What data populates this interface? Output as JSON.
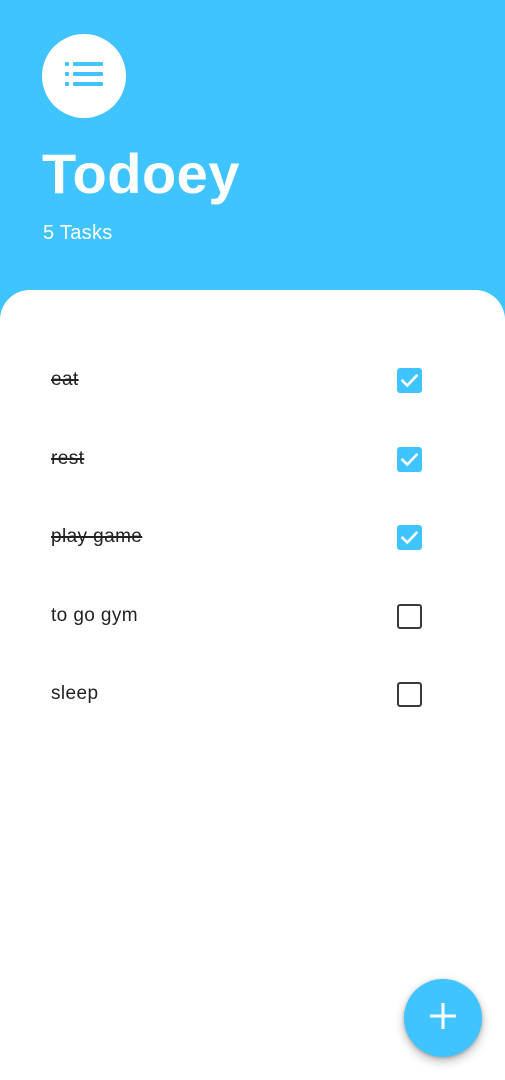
{
  "colors": {
    "accent": "#40C4FF",
    "background": "#FFFFFF",
    "text": "#222222"
  },
  "header": {
    "icon": "list-icon",
    "title": "Todoey",
    "task_count": "5 Tasks"
  },
  "tasks": [
    {
      "label": "eat",
      "done": true
    },
    {
      "label": "rest",
      "done": true
    },
    {
      "label": "play game",
      "done": true
    },
    {
      "label": "to go gym",
      "done": false
    },
    {
      "label": "sleep",
      "done": false
    }
  ],
  "fab": {
    "icon": "plus-icon"
  }
}
